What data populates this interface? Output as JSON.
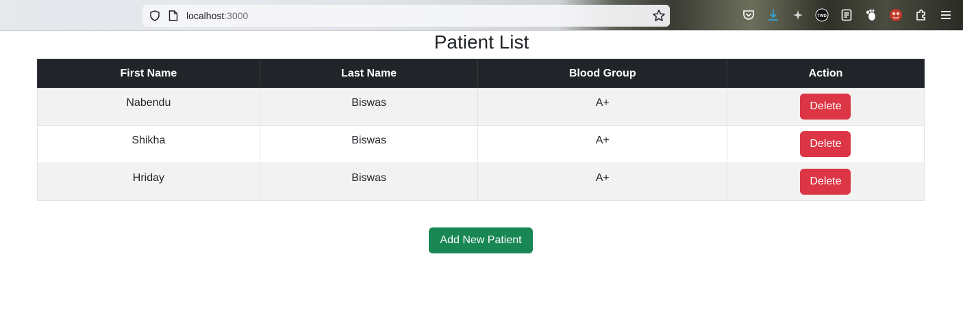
{
  "browser": {
    "url_host": "localhost",
    "url_port": ":3000",
    "icons": [
      "shield-icon",
      "page-icon",
      "bookmark-star-icon",
      "pocket-icon",
      "download-icon",
      "extension-tw-icon",
      "notes-icon",
      "gnome-icon",
      "extension-red-icon",
      "extensions-puzzle-icon",
      "menu-icon"
    ]
  },
  "page": {
    "title": "Patient List",
    "table": {
      "headers": [
        "First Name",
        "Last Name",
        "Blood Group",
        "Action"
      ],
      "rows": [
        {
          "first": "Nabendu",
          "last": "Biswas",
          "blood": "A+",
          "action": "Delete"
        },
        {
          "first": "Shikha",
          "last": "Biswas",
          "blood": "A+",
          "action": "Delete"
        },
        {
          "first": "Hriday",
          "last": "Biswas",
          "blood": "A+",
          "action": "Delete"
        }
      ]
    },
    "add_button": "Add New Patient"
  },
  "colors": {
    "header_bg": "#212529",
    "delete": "#dc3545",
    "add": "#198754",
    "stripe": "#f2f2f2"
  }
}
